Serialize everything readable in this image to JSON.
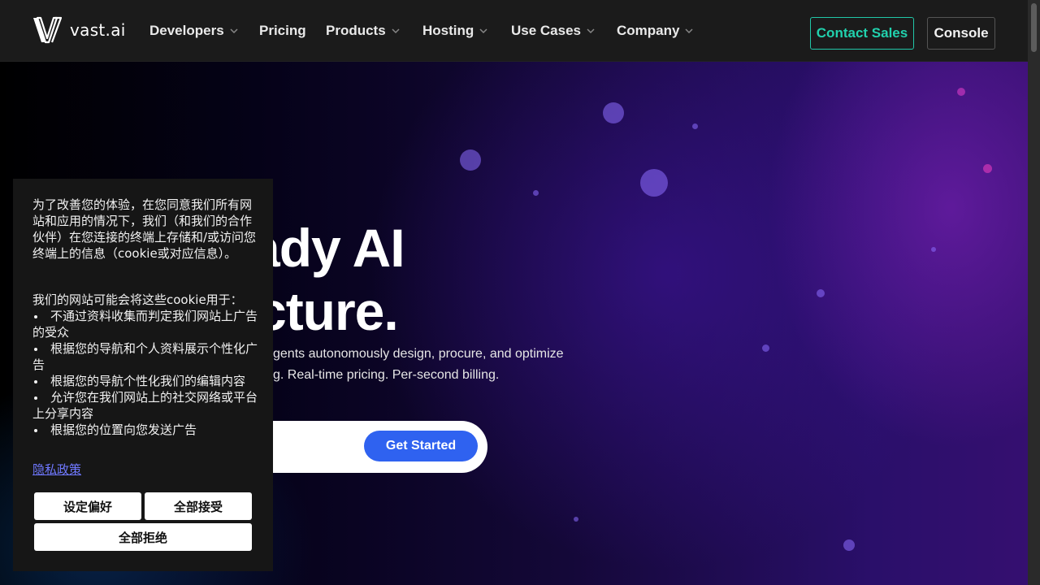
{
  "header": {
    "logo_text": "vast.ai",
    "nav": [
      {
        "label": "Developers",
        "has_menu": true
      },
      {
        "label": "Pricing",
        "has_menu": false
      },
      {
        "label": "Products",
        "has_menu": true
      },
      {
        "label": "Hosting",
        "has_menu": true
      },
      {
        "label": "Use Cases",
        "has_menu": true
      },
      {
        "label": "Company",
        "has_menu": true
      }
    ],
    "contact_sales": "Contact Sales",
    "console": "Console"
  },
  "hero": {
    "title_line1": "ady AI",
    "title_line2": "cture.",
    "subtitle_line1": "gents autonomously design, procure, and optimize",
    "subtitle_line2": "g. Real-time pricing. Per-second billing.",
    "cta_label": "Get Started"
  },
  "cookie": {
    "intro": "为了改善您的体验，在您同意我们所有网站和应用的情况下，我们（和我们的合作伙伴）在您连接的终端上存储和/或访问您终端上的信息（cookie或对应信息）。",
    "uses_heading": "我们的网站可能会将这些cookie用于：",
    "uses": [
      "不通过资料收集而判定我们网站上广告的受众",
      "根据您的导航和个人资料展示个性化广告",
      "根据您的导航个性化我们的编辑内容",
      "允许您在我们网站上的社交网络或平台上分享内容",
      "根据您的位置向您发送广告"
    ],
    "privacy_link": "隐私政策",
    "btn_preferences": "设定偏好",
    "btn_accept_all": "全部接受",
    "btn_reject_all": "全部拒绝"
  },
  "colors": {
    "accent": "#21d1ad",
    "cta": "#2f62f0",
    "header_bg": "#1b1b1b",
    "link": "#6f78ff"
  },
  "icons": {
    "logo": "vast-logo-icon",
    "menu_caret": "chevron-down-icon"
  }
}
